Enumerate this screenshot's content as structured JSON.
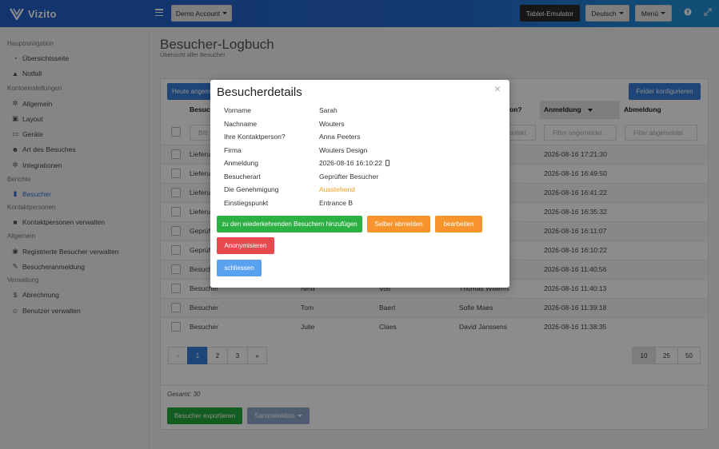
{
  "app": {
    "name": "Vizito"
  },
  "topbar": {
    "account": "Demo Account",
    "tablet_emulator": "Tablet-Emulator",
    "language": "Deutsch",
    "menu": "Menü",
    "help_icon": "question-circle-icon",
    "expand_icon": "expand-icon"
  },
  "sidebar": {
    "sections": [
      {
        "heading": "Hauptnavigation",
        "items": [
          {
            "label": "Übersichtsseite",
            "icon": "dashboard-icon"
          },
          {
            "label": "Notfall",
            "icon": "warning-icon"
          }
        ]
      },
      {
        "heading": "Kontoeinstellungen",
        "items": [
          {
            "label": "Allgemein",
            "icon": "gear-icon"
          },
          {
            "label": "Layout",
            "icon": "image-icon"
          },
          {
            "label": "Geräte",
            "icon": "tablet-icon"
          },
          {
            "label": "Art des Besuches",
            "icon": "users-icon"
          },
          {
            "label": "Integrationen",
            "icon": "cog-icon"
          }
        ]
      },
      {
        "heading": "Berichte",
        "items": [
          {
            "label": "Besucher",
            "icon": "book-icon",
            "active": true
          }
        ]
      },
      {
        "heading": "Kontaktpersonen",
        "items": [
          {
            "label": "Kontaktpersonen verwalten",
            "icon": "user-tie-icon"
          }
        ]
      },
      {
        "heading": "Allgemein",
        "items": [
          {
            "label": "Registrierte Besucher verwalten",
            "icon": "user-check-icon"
          },
          {
            "label": "Besucheranmeldung",
            "icon": "pencil-icon"
          }
        ]
      },
      {
        "heading": "Verwaltung",
        "items": [
          {
            "label": "Abrechnung",
            "icon": "dollar-icon"
          },
          {
            "label": "Benutzer verwalten",
            "icon": "user-plus-icon"
          }
        ]
      }
    ]
  },
  "page": {
    "title": "Besucher-Logbuch",
    "subtitle": "Übersicht aller Besucher"
  },
  "toolbar": {
    "today_button": "Heute angem",
    "configure_fields": "Felder konfigurieren"
  },
  "table": {
    "headers": {
      "col1": "Besuch",
      "contact": "on?",
      "login": "Anmeldung",
      "logout": "Abmeldung"
    },
    "filters": {
      "col1": "Bitt",
      "contact": "Kontakt",
      "login": "Filter angemeldet",
      "logout": "Filter abgemeldet"
    },
    "rows": [
      {
        "type": "Lieferu",
        "first": "",
        "last": "",
        "contact": "",
        "login": "2026-08-16 17:21:30"
      },
      {
        "type": "Lieferu",
        "first": "",
        "last": "",
        "contact": "",
        "login": "2026-08-16 16:49:50"
      },
      {
        "type": "Lieferu",
        "first": "",
        "last": "",
        "contact": "",
        "login": "2026-08-16 16:41:22"
      },
      {
        "type": "Lieferu",
        "first": "",
        "last": "",
        "contact": "",
        "login": "2026-08-16 16:35:32"
      },
      {
        "type": "Geprüf",
        "first": "",
        "last": "",
        "contact": "",
        "login": "2026-08-16 16:11:07"
      },
      {
        "type": "Geprüf",
        "first": "",
        "last": "",
        "contact": "",
        "login": "2026-08-16 16:10:22"
      },
      {
        "type": "Besuch",
        "first": "",
        "last": "",
        "contact": "",
        "login": "2026-08-16 11:40:56"
      },
      {
        "type": "Besucher",
        "first": "Nina",
        "last": "Vos",
        "contact": "Thomas Willems",
        "login": "2026-08-16 11:40:13"
      },
      {
        "type": "Besucher",
        "first": "Tom",
        "last": "Baert",
        "contact": "Sofie Maes",
        "login": "2026-08-16 11:39:18"
      },
      {
        "type": "Besucher",
        "first": "Julie",
        "last": "Claes",
        "contact": "David Janssens",
        "login": "2026-08-16 11:38:35"
      }
    ]
  },
  "pagination": {
    "prev": "«",
    "pages": [
      "1",
      "2",
      "3"
    ],
    "next": "»",
    "current": "1",
    "page_sizes": [
      "10",
      "25",
      "50"
    ],
    "selected_size": "10"
  },
  "footer": {
    "total": "Gesamt: 30",
    "export_button": "Besucher exportieren",
    "bulk_action": "Sammelaktion"
  },
  "modal": {
    "title": "Besucherdetails",
    "close": "×",
    "fields": [
      {
        "label": "Vorname",
        "value": "Sarah"
      },
      {
        "label": "Nachname",
        "value": "Wouters"
      },
      {
        "label": "Ihre Kontaktperson?",
        "value": "Anna Peeters"
      },
      {
        "label": "Firma",
        "value": "Wouters Design"
      },
      {
        "label": "Anmeldung",
        "value": "2026-08-16 16:10:22"
      },
      {
        "label": "Besucherart",
        "value": "Geprüfter Besucher"
      },
      {
        "label": "Die Genehmigung",
        "value": "Ausstehend"
      },
      {
        "label": "Einstiegspunkt",
        "value": "Entrance B"
      }
    ],
    "buttons": {
      "add_recurring": "zu den wiederkehrenden Besuchern hinzufügen",
      "self_logout": "Selber abmelden",
      "edit": "bearbeiten",
      "anonymize": "Anonymisieren",
      "close": "schliessen"
    },
    "status_color": "#f0a020"
  }
}
